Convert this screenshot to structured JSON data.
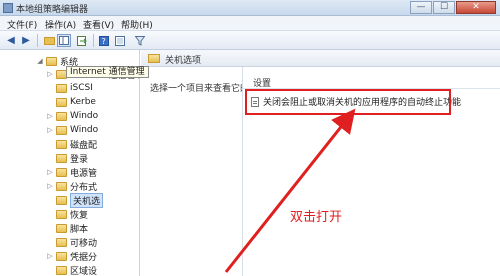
{
  "window": {
    "title": "本地组策略编辑器",
    "controls": {
      "minimize": "—",
      "maximize": "☐",
      "close": "✕"
    }
  },
  "menu": [
    "文件(F)",
    "操作(A)",
    "查看(V)",
    "帮助(H)"
  ],
  "toolbar": {
    "buttons": [
      "back-arrow-icon",
      "forward-arrow-icon",
      "folder-up-icon",
      "show-hide-tree-icon",
      "export-icon",
      "help-icon",
      "properties-icon",
      "filter-icon"
    ]
  },
  "tree": {
    "root": "系统",
    "items": [
      "Internet 通信管理",
      "iSCSI",
      "Kerbe",
      "Windo",
      "Windo",
      "磁盘配",
      "登录",
      "电源管",
      "分布式",
      "关机选",
      "恢复",
      "脚本",
      "可移动",
      "凭据分",
      "区域设"
    ],
    "tooltip": "Internet 通信管理"
  },
  "header": {
    "title": "关机选项"
  },
  "description": {
    "text": "选择一个项目来查看它的描述。"
  },
  "list": {
    "column_header": "设置",
    "rows": [
      "关闭会阻止或取消关机的应用程序的自动终止功能"
    ]
  },
  "annotation": {
    "text": "双击打开",
    "color": "#e02020"
  },
  "colors": {
    "accent_red": "#e02020",
    "selection_blue": "#cfe3fb",
    "folder_yellow": "#e7bf52"
  }
}
